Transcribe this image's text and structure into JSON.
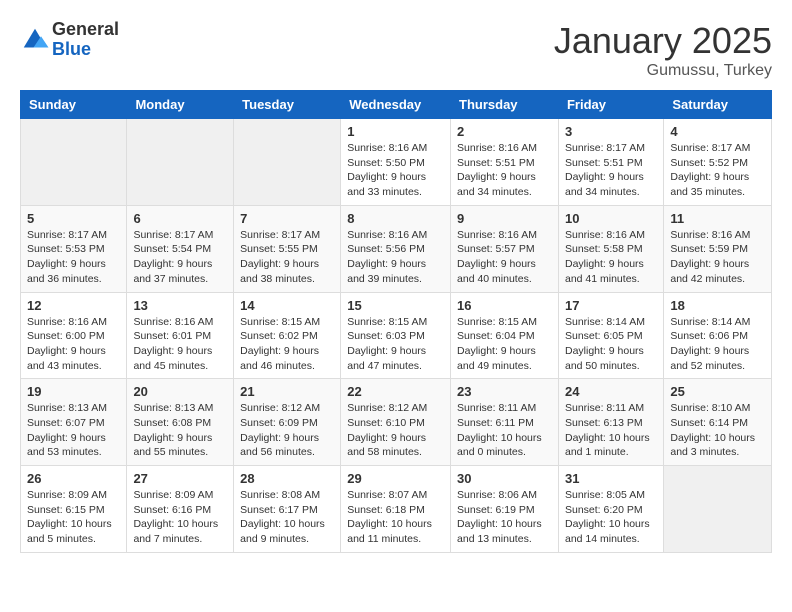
{
  "logo": {
    "general": "General",
    "blue": "Blue"
  },
  "title": "January 2025",
  "location": "Gumussu, Turkey",
  "weekdays": [
    "Sunday",
    "Monday",
    "Tuesday",
    "Wednesday",
    "Thursday",
    "Friday",
    "Saturday"
  ],
  "weeks": [
    [
      {
        "day": "",
        "info": ""
      },
      {
        "day": "",
        "info": ""
      },
      {
        "day": "",
        "info": ""
      },
      {
        "day": "1",
        "info": "Sunrise: 8:16 AM\nSunset: 5:50 PM\nDaylight: 9 hours and 33 minutes."
      },
      {
        "day": "2",
        "info": "Sunrise: 8:16 AM\nSunset: 5:51 PM\nDaylight: 9 hours and 34 minutes."
      },
      {
        "day": "3",
        "info": "Sunrise: 8:17 AM\nSunset: 5:51 PM\nDaylight: 9 hours and 34 minutes."
      },
      {
        "day": "4",
        "info": "Sunrise: 8:17 AM\nSunset: 5:52 PM\nDaylight: 9 hours and 35 minutes."
      }
    ],
    [
      {
        "day": "5",
        "info": "Sunrise: 8:17 AM\nSunset: 5:53 PM\nDaylight: 9 hours and 36 minutes."
      },
      {
        "day": "6",
        "info": "Sunrise: 8:17 AM\nSunset: 5:54 PM\nDaylight: 9 hours and 37 minutes."
      },
      {
        "day": "7",
        "info": "Sunrise: 8:17 AM\nSunset: 5:55 PM\nDaylight: 9 hours and 38 minutes."
      },
      {
        "day": "8",
        "info": "Sunrise: 8:16 AM\nSunset: 5:56 PM\nDaylight: 9 hours and 39 minutes."
      },
      {
        "day": "9",
        "info": "Sunrise: 8:16 AM\nSunset: 5:57 PM\nDaylight: 9 hours and 40 minutes."
      },
      {
        "day": "10",
        "info": "Sunrise: 8:16 AM\nSunset: 5:58 PM\nDaylight: 9 hours and 41 minutes."
      },
      {
        "day": "11",
        "info": "Sunrise: 8:16 AM\nSunset: 5:59 PM\nDaylight: 9 hours and 42 minutes."
      }
    ],
    [
      {
        "day": "12",
        "info": "Sunrise: 8:16 AM\nSunset: 6:00 PM\nDaylight: 9 hours and 43 minutes."
      },
      {
        "day": "13",
        "info": "Sunrise: 8:16 AM\nSunset: 6:01 PM\nDaylight: 9 hours and 45 minutes."
      },
      {
        "day": "14",
        "info": "Sunrise: 8:15 AM\nSunset: 6:02 PM\nDaylight: 9 hours and 46 minutes."
      },
      {
        "day": "15",
        "info": "Sunrise: 8:15 AM\nSunset: 6:03 PM\nDaylight: 9 hours and 47 minutes."
      },
      {
        "day": "16",
        "info": "Sunrise: 8:15 AM\nSunset: 6:04 PM\nDaylight: 9 hours and 49 minutes."
      },
      {
        "day": "17",
        "info": "Sunrise: 8:14 AM\nSunset: 6:05 PM\nDaylight: 9 hours and 50 minutes."
      },
      {
        "day": "18",
        "info": "Sunrise: 8:14 AM\nSunset: 6:06 PM\nDaylight: 9 hours and 52 minutes."
      }
    ],
    [
      {
        "day": "19",
        "info": "Sunrise: 8:13 AM\nSunset: 6:07 PM\nDaylight: 9 hours and 53 minutes."
      },
      {
        "day": "20",
        "info": "Sunrise: 8:13 AM\nSunset: 6:08 PM\nDaylight: 9 hours and 55 minutes."
      },
      {
        "day": "21",
        "info": "Sunrise: 8:12 AM\nSunset: 6:09 PM\nDaylight: 9 hours and 56 minutes."
      },
      {
        "day": "22",
        "info": "Sunrise: 8:12 AM\nSunset: 6:10 PM\nDaylight: 9 hours and 58 minutes."
      },
      {
        "day": "23",
        "info": "Sunrise: 8:11 AM\nSunset: 6:11 PM\nDaylight: 10 hours and 0 minutes."
      },
      {
        "day": "24",
        "info": "Sunrise: 8:11 AM\nSunset: 6:13 PM\nDaylight: 10 hours and 1 minute."
      },
      {
        "day": "25",
        "info": "Sunrise: 8:10 AM\nSunset: 6:14 PM\nDaylight: 10 hours and 3 minutes."
      }
    ],
    [
      {
        "day": "26",
        "info": "Sunrise: 8:09 AM\nSunset: 6:15 PM\nDaylight: 10 hours and 5 minutes."
      },
      {
        "day": "27",
        "info": "Sunrise: 8:09 AM\nSunset: 6:16 PM\nDaylight: 10 hours and 7 minutes."
      },
      {
        "day": "28",
        "info": "Sunrise: 8:08 AM\nSunset: 6:17 PM\nDaylight: 10 hours and 9 minutes."
      },
      {
        "day": "29",
        "info": "Sunrise: 8:07 AM\nSunset: 6:18 PM\nDaylight: 10 hours and 11 minutes."
      },
      {
        "day": "30",
        "info": "Sunrise: 8:06 AM\nSunset: 6:19 PM\nDaylight: 10 hours and 13 minutes."
      },
      {
        "day": "31",
        "info": "Sunrise: 8:05 AM\nSunset: 6:20 PM\nDaylight: 10 hours and 14 minutes."
      },
      {
        "day": "",
        "info": ""
      }
    ]
  ]
}
